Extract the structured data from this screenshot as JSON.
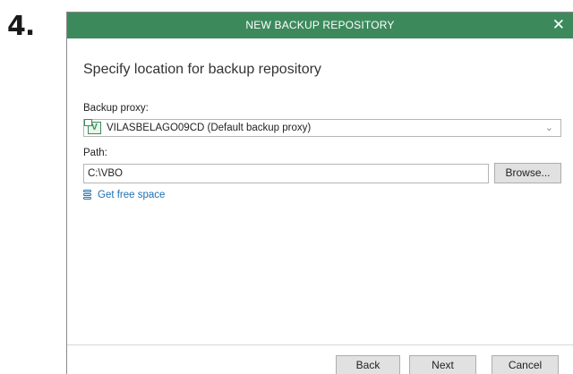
{
  "step_number": "4.",
  "dialog": {
    "title": "NEW BACKUP REPOSITORY",
    "close_glyph": "✕",
    "heading": "Specify location for backup repository",
    "proxy": {
      "label": "Backup proxy:",
      "icon": "veeam-proxy-icon",
      "icon_glyph": "V",
      "value": "VILASBELAGO09CD (Default backup proxy)",
      "chevron_glyph": "⌄"
    },
    "path": {
      "label": "Path:",
      "value": "C:\\VBO"
    },
    "browse_label": "Browse...",
    "free_space_link": "Get free space",
    "buttons": {
      "back": "Back",
      "next": "Next",
      "cancel": "Cancel"
    }
  },
  "colors": {
    "titlebar": "#3c8a5c",
    "link": "#1d6fb5"
  }
}
